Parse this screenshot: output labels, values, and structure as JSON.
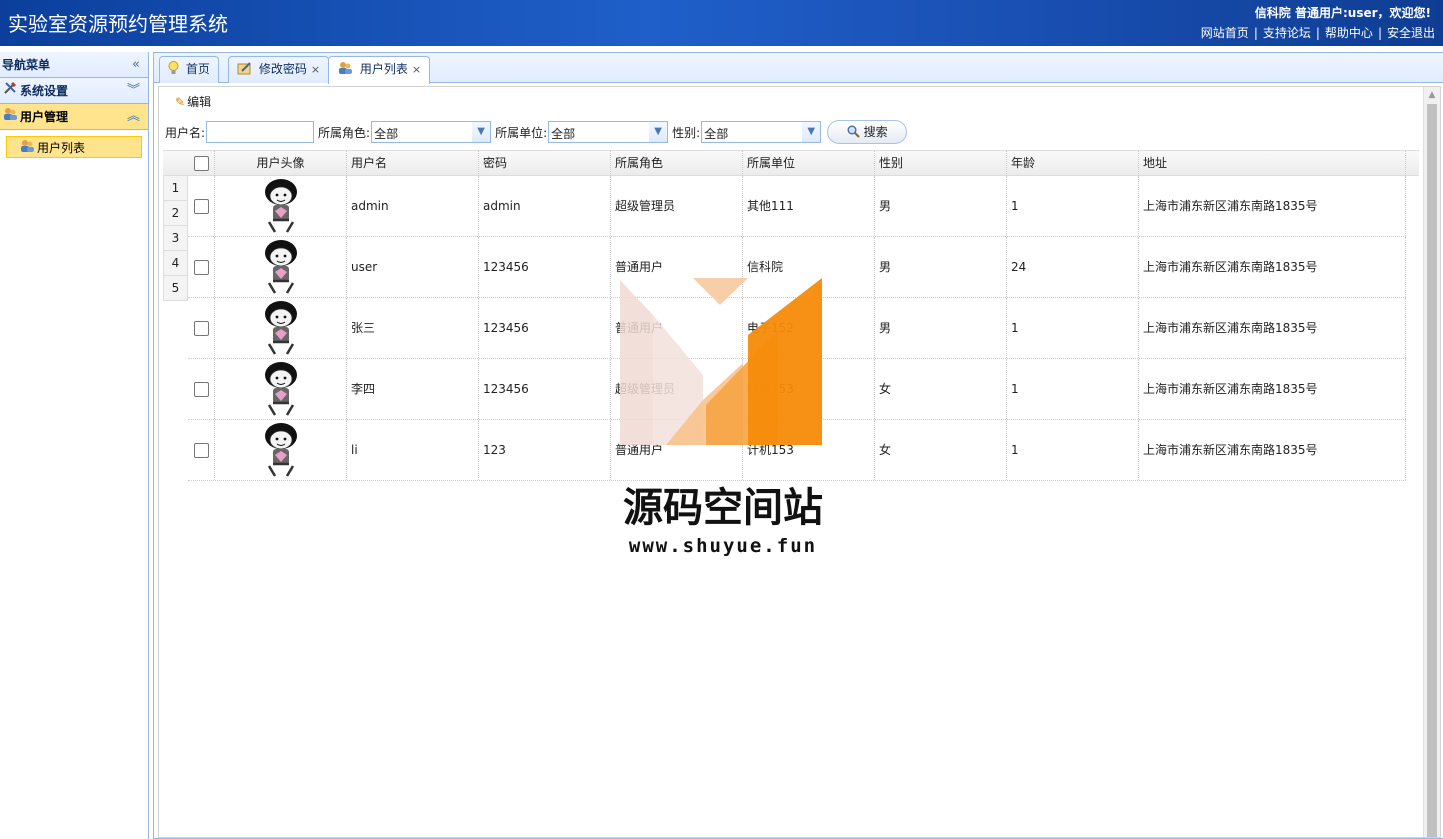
{
  "header": {
    "title": "实验室资源预约管理系统",
    "welcome": "信科院 普通用户:user，欢迎您!",
    "links": [
      "网站首页",
      "支持论坛",
      "帮助中心",
      "安全退出"
    ]
  },
  "sidebar": {
    "nav_title": "导航菜单",
    "groups": [
      {
        "label": "系统设置"
      },
      {
        "label": "用户管理"
      }
    ],
    "items": [
      {
        "label": "用户列表"
      }
    ]
  },
  "tabs": [
    {
      "label": "首页"
    },
    {
      "label": "修改密码"
    },
    {
      "label": "用户列表"
    }
  ],
  "toolbar": {
    "edit_label": "编辑"
  },
  "search": {
    "username_label": "用户名:",
    "role_label": "所属角色:",
    "role_value": "全部",
    "unit_label": "所属单位:",
    "unit_value": "全部",
    "gender_label": "性别:",
    "gender_value": "全部",
    "button_label": "搜索"
  },
  "table": {
    "columns": [
      "用户头像",
      "用户名",
      "密码",
      "所属角色",
      "所属单位",
      "性别",
      "年龄",
      "地址"
    ],
    "row_numbers": [
      "1",
      "2",
      "3",
      "4",
      "5"
    ],
    "rows": [
      {
        "username": "admin",
        "password": "admin",
        "role": "超级管理员",
        "unit": "其他111",
        "gender": "男",
        "age": "1",
        "address": "上海市浦东新区浦东南路1835号"
      },
      {
        "username": "user",
        "password": "123456",
        "role": "普通用户",
        "unit": "信科院",
        "gender": "男",
        "age": "24",
        "address": "上海市浦东新区浦东南路1835号"
      },
      {
        "username": "张三",
        "password": "123456",
        "role": "普通用户",
        "unit": "电子152",
        "gender": "男",
        "age": "1",
        "address": "上海市浦东新区浦东南路1835号"
      },
      {
        "username": "李四",
        "password": "123456",
        "role": "超级管理员",
        "unit": "计机153",
        "gender": "女",
        "age": "1",
        "address": "上海市浦东新区浦东南路1835号"
      },
      {
        "username": "li",
        "password": "123",
        "role": "普通用户",
        "unit": "计机153",
        "gender": "女",
        "age": "1",
        "address": "上海市浦东新区浦东南路1835号"
      }
    ]
  },
  "watermark": {
    "title": "源码空间站",
    "url": "www.shuyue.fun"
  },
  "colors": {
    "header_bg": "#1f5fc9",
    "accent_border": "#95b8e7",
    "active_item": "#ffe48d",
    "watermark_orange": "#f68b0a"
  }
}
